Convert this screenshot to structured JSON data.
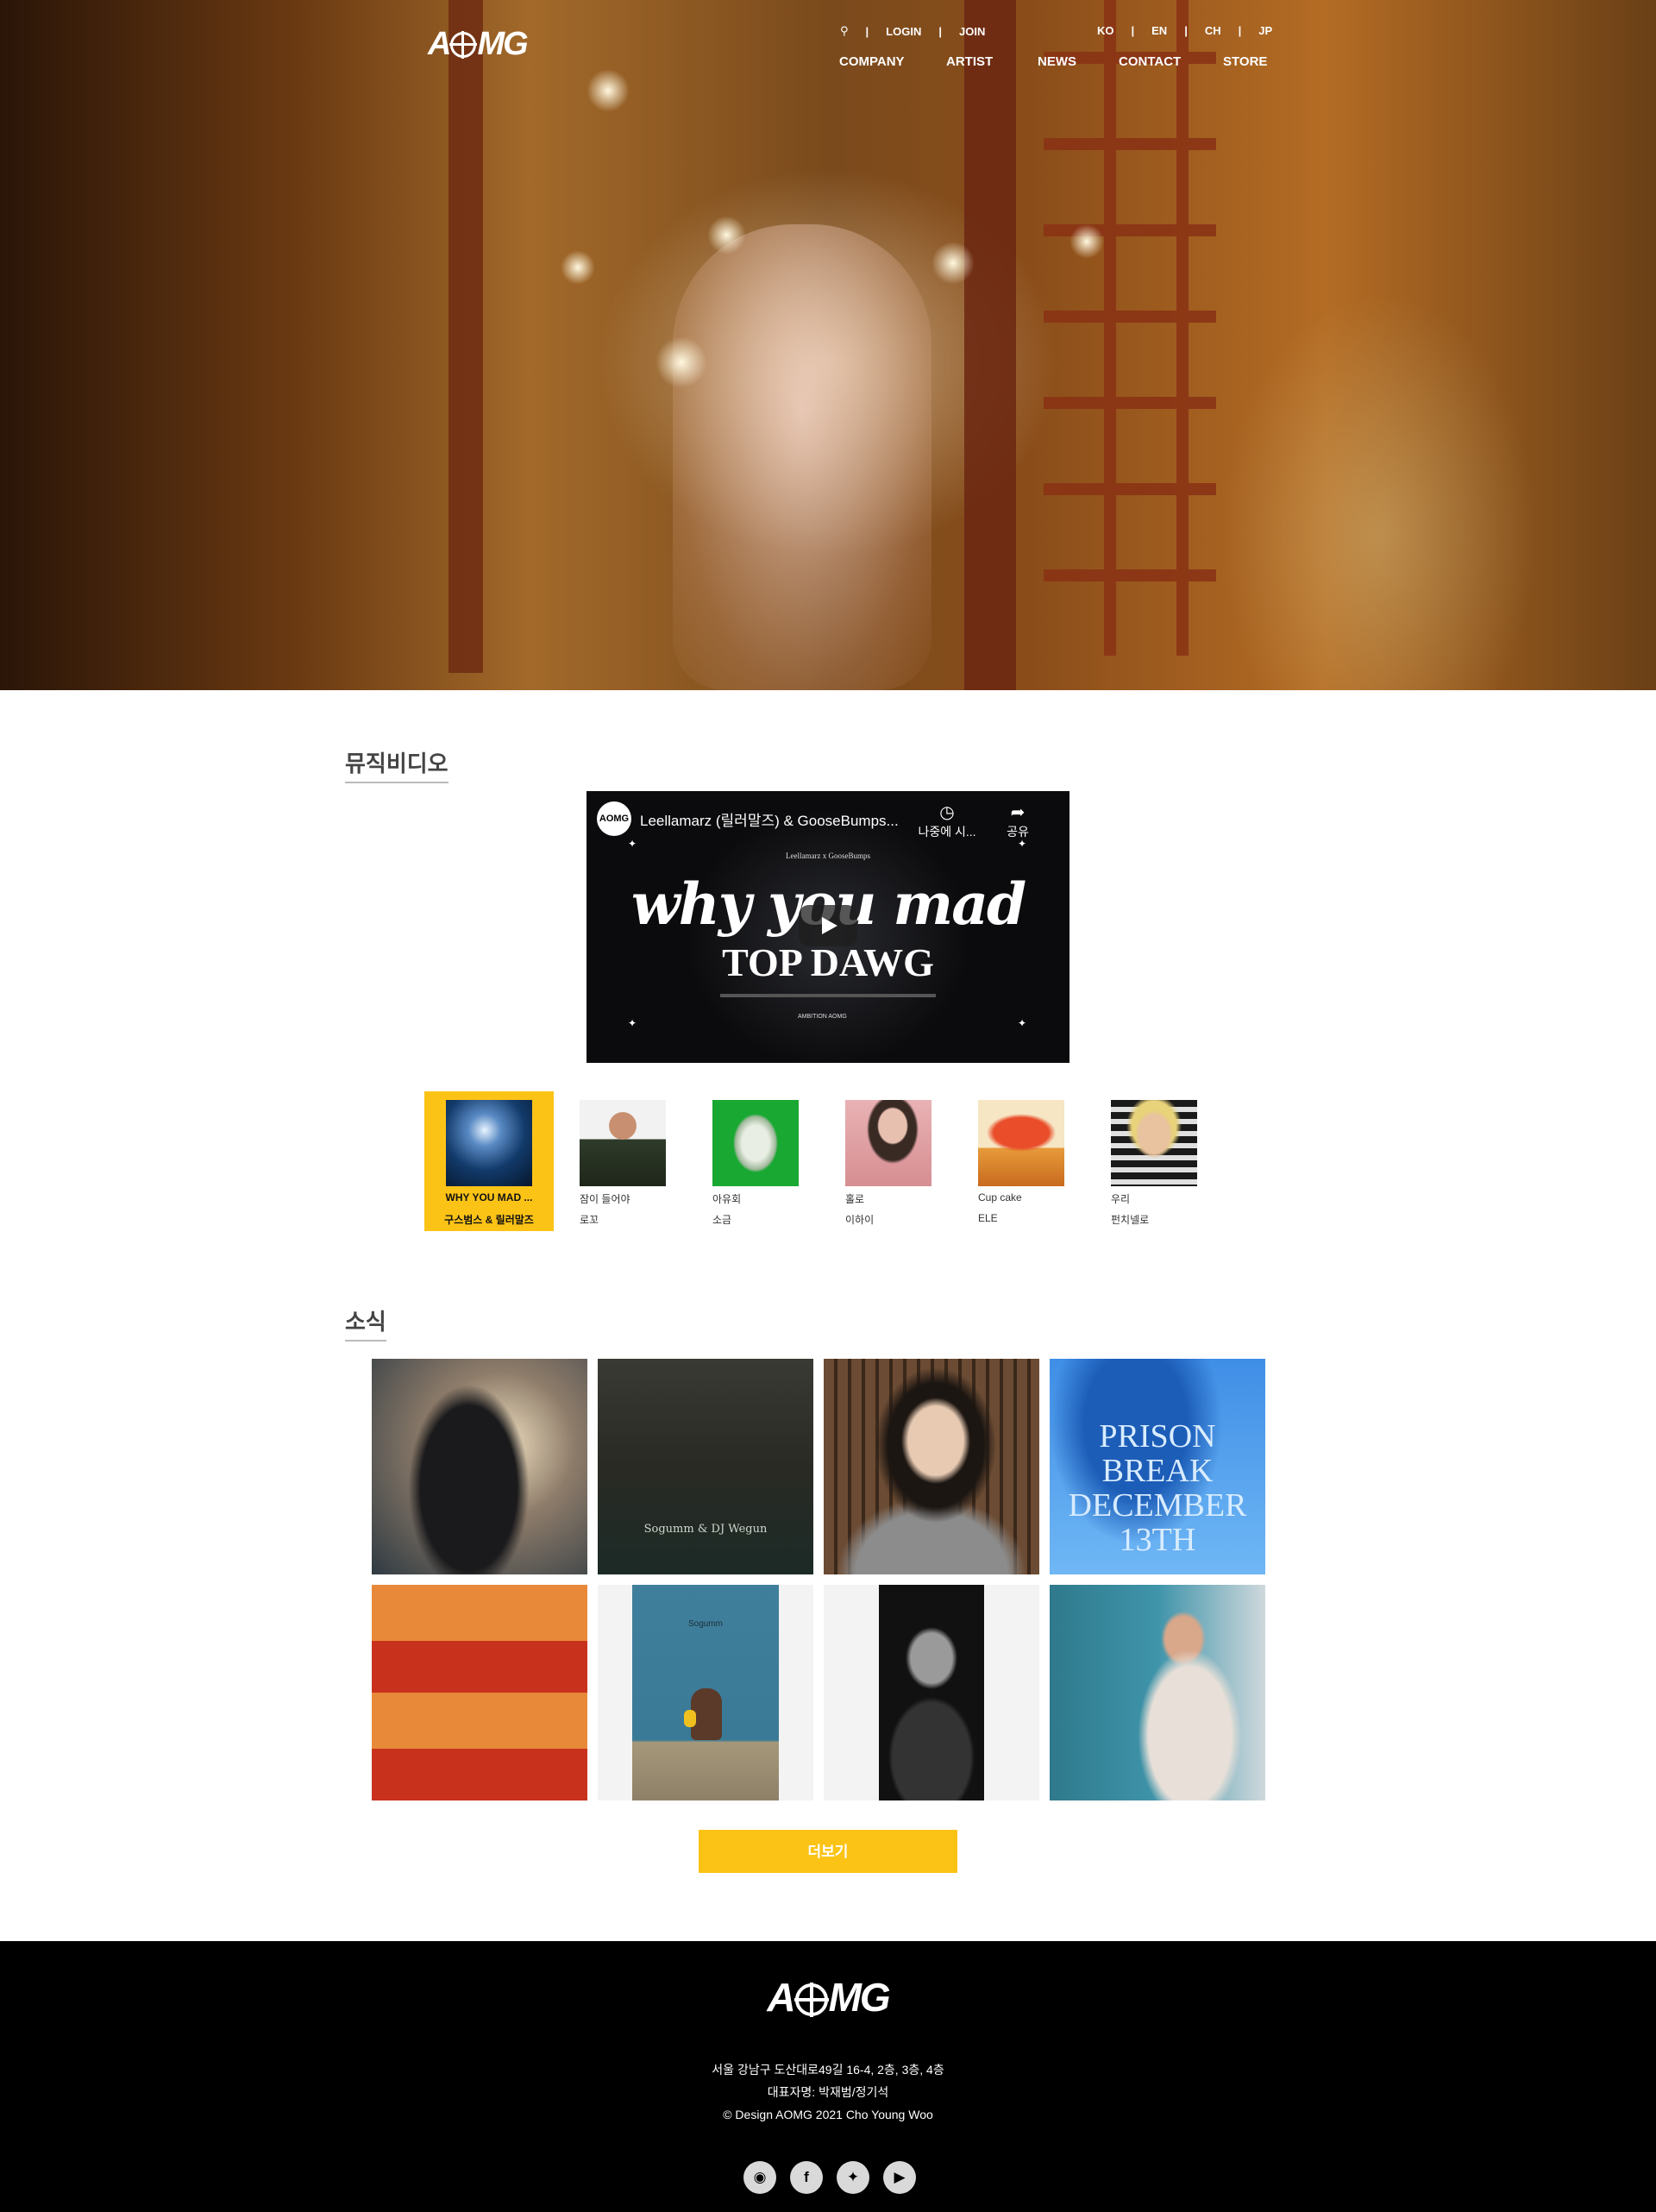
{
  "header": {
    "logo_text": "AOMG",
    "util": {
      "search_icon": "search-icon",
      "login": "LOGIN",
      "join": "JOIN"
    },
    "langs": [
      "KO",
      "EN",
      "CH",
      "JP"
    ],
    "nav": [
      "COMPANY",
      "ARTIST",
      "NEWS",
      "CONTACT",
      "STORE"
    ]
  },
  "mv_section": {
    "title": "뮤직비디오",
    "player": {
      "channel": "AOMG",
      "title": "Leellamarz (릴러말즈) & GooseBumps...",
      "watch_later": "나중에 시...",
      "share": "공유",
      "small_text": "Leellamarz x GooseBumps",
      "big_line1": "why you mad",
      "big_line2": "TOP DAWG",
      "footer_label": "AMBITION   AOMG"
    },
    "items": [
      {
        "title": "WHY YOU MAD ...",
        "artist": "구스범스 & 릴러말즈",
        "active": true
      },
      {
        "title": "잠이 들어야",
        "artist": "로꼬",
        "active": false
      },
      {
        "title": "아유회",
        "artist": "소금",
        "active": false
      },
      {
        "title": "홀로",
        "artist": "이하이",
        "active": false
      },
      {
        "title": "Cup cake",
        "artist": "ELE",
        "active": false
      },
      {
        "title": "우리",
        "artist": "펀치넬로",
        "active": false
      }
    ]
  },
  "news_section": {
    "title": "소식",
    "more_button": "더보기",
    "tiles": [
      {
        "overlay_text": ""
      },
      {
        "overlay_text": "Sogumm & DJ Wegun"
      },
      {
        "overlay_text": ""
      },
      {
        "overlay_text": "PRISON BREAK DECEMBER 13TH"
      },
      {
        "overlay_text": ""
      },
      {
        "overlay_text": "Sogumm"
      },
      {
        "overlay_text": ""
      },
      {
        "overlay_text": ""
      }
    ]
  },
  "footer": {
    "logo_text": "AOMG",
    "address": "서울 강남구 도산대로49길 16-4, 2층, 3층, 4층",
    "ceo": "대표자명: 박재범/정기석",
    "copyright": "© Design AOMG 2021 Cho Young Woo",
    "social": [
      "instagram-icon",
      "facebook-icon",
      "twitter-icon",
      "youtube-icon"
    ]
  },
  "colors": {
    "accent": "#fcc317",
    "footer_bg": "#000000"
  }
}
